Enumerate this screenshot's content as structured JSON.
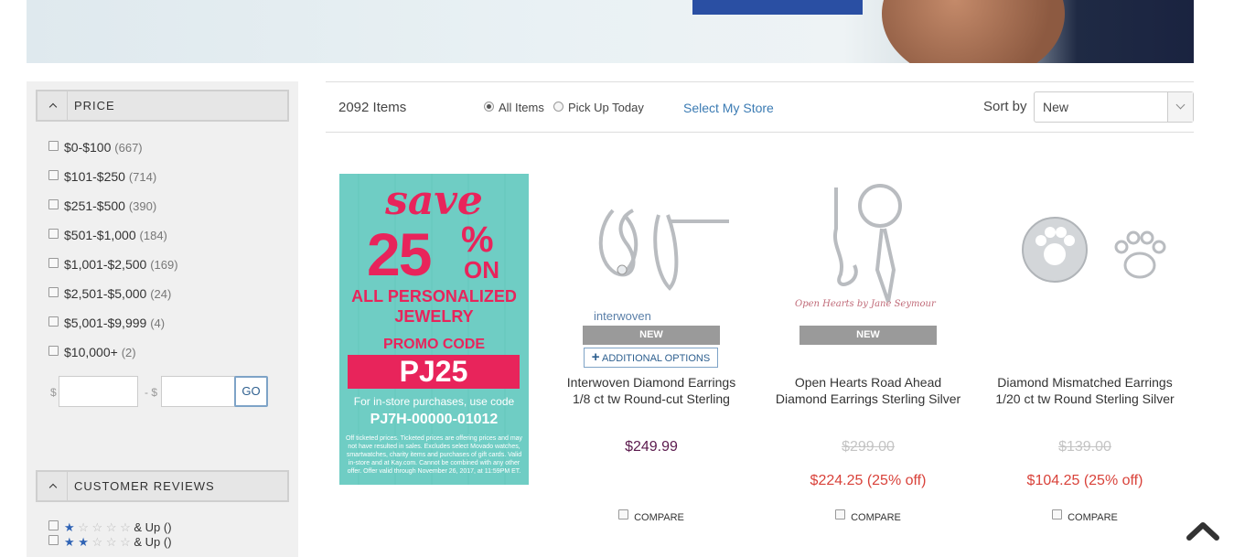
{
  "hero": {},
  "sidebar": {
    "price_title": "PRICE",
    "price_options": [
      {
        "label": "$0-$100",
        "count": "(667)"
      },
      {
        "label": "$101-$250",
        "count": "(714)"
      },
      {
        "label": "$251-$500",
        "count": "(390)"
      },
      {
        "label": "$501-$1,000",
        "count": "(184)"
      },
      {
        "label": "$1,001-$2,500",
        "count": "(169)"
      },
      {
        "label": "$2,501-$5,000",
        "count": "(24)"
      },
      {
        "label": "$5,001-$9,999",
        "count": "(4)"
      },
      {
        "label": "$10,000+",
        "count": "(2)"
      }
    ],
    "range_currency": "$",
    "range_separator": "- $",
    "go_label": "GO",
    "reviews_title": "CUSTOMER REVIEWS",
    "review_rows": [
      {
        "stars_filled": 1,
        "label": "& Up ()"
      },
      {
        "stars_filled": 2,
        "label": "& Up ()"
      }
    ]
  },
  "toolbar": {
    "items_count": "2092 Items",
    "radio_all": "All Items",
    "radio_pickup": "Pick Up Today",
    "selected_radio": "All Items",
    "store_link": "Select My Store",
    "sort_label": "Sort by",
    "sort_value": "New"
  },
  "promo": {
    "save": "save",
    "percent": "25",
    "percent_sign": "%",
    "on": "ON",
    "line1": "ALL PERSONALIZED",
    "line2": "JEWELRY",
    "promo_code_label": "PROMO CODE",
    "promo_code": "PJ25",
    "instore_text": "For in-store purchases, use code",
    "instore_code": "PJ7H-00000-01012",
    "fine_print": "Off ticketed prices. Ticketed prices are offering prices and may not have resulted in sales. Excludes select Movado watches, smartwatches, charity items and purchases of gift cards. Valid in-store and at Kay.com. Cannot be combined with any other offer. Offer valid through November 26, 2017, at 11:59PM ET."
  },
  "products": [
    {
      "brand": "interwoven",
      "badge": "NEW",
      "additional_options": "ADDITIONAL OPTIONS",
      "title_line1": "Interwoven Diamond Earrings",
      "title_line2": "1/8 ct tw Round-cut Sterling",
      "price": "$249.99",
      "compare": "COMPARE"
    },
    {
      "brand": "Open Hearts by Jane Seymour",
      "badge": "NEW",
      "title_line1": "Open Hearts Road Ahead",
      "title_line2": "Diamond Earrings Sterling Silver",
      "original_price": "$299.00",
      "sale_price": "$224.25 (25% off)",
      "compare": "COMPARE"
    },
    {
      "title_line1": "Diamond Mismatched Earrings",
      "title_line2": "1/20 ct tw Round Sterling Silver",
      "original_price": "$139.00",
      "sale_price": "$104.25 (25% off)",
      "compare": "COMPARE"
    }
  ],
  "icons": {
    "back_to_top": "chevron-up-icon"
  },
  "colors": {
    "accent_link": "#3b7bb3",
    "sale_red": "#d9423a",
    "price_purple": "#5b1a4d",
    "promo_pink": "#e8245b",
    "promo_teal": "#6fcdc4"
  }
}
